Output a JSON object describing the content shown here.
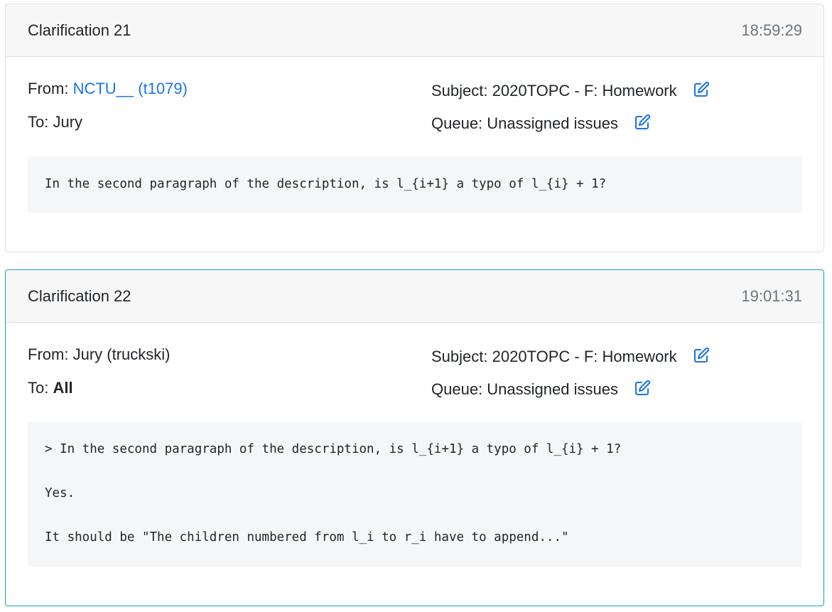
{
  "clarifications": [
    {
      "title": "Clarification 21",
      "time": "18:59:29",
      "from_label": "From:",
      "from_value": "NCTU__ (t1079)",
      "to_label": "To:",
      "to_value": "Jury",
      "subject_label": "Subject:",
      "subject_value": "2020TOPC - F: Homework",
      "queue_label": "Queue:",
      "queue_value": "Unassigned issues",
      "message": "In the second paragraph of the description, is l_{i+1} a typo of l_{i} + 1?"
    },
    {
      "title": "Clarification 22",
      "time": "19:01:31",
      "from_label": "From:",
      "from_value": "Jury (truckski)",
      "to_label": "To:",
      "to_value": "All",
      "subject_label": "Subject:",
      "subject_value": "2020TOPC - F: Homework",
      "queue_label": "Queue:",
      "queue_value": "Unassigned issues",
      "message": "> In the second paragraph of the description, is l_{i+1} a typo of l_{i} + 1?\n\nYes.\n\nIt should be \"The children numbered from l_i to r_i have to append...\""
    }
  ],
  "icons": {
    "edit": "edit-icon"
  },
  "colors": {
    "link": "#1a73e8",
    "highlight_border": "#17a2b8"
  }
}
